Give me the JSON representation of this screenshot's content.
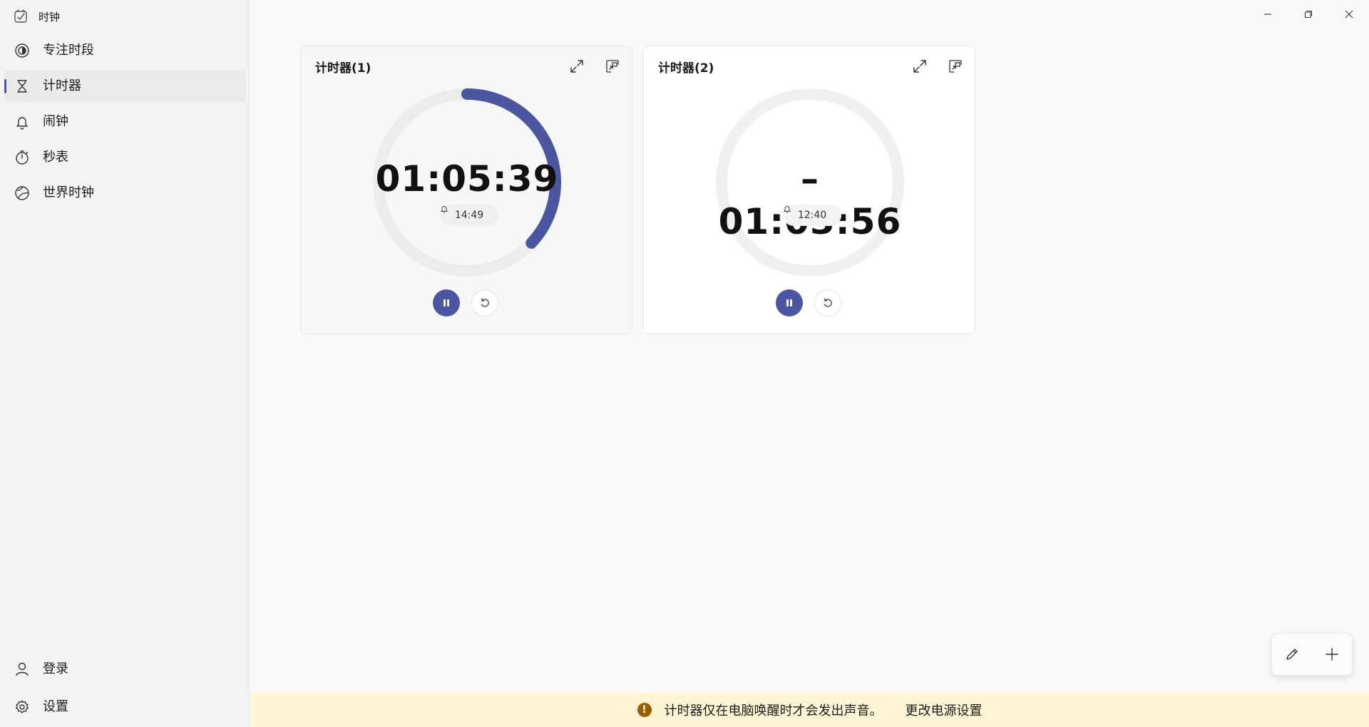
{
  "app": {
    "title": "时钟",
    "icon": "clock-app-icon"
  },
  "sidebar": {
    "items": [
      {
        "label": "专注时段",
        "icon": "focus-icon"
      },
      {
        "label": "计时器",
        "icon": "hourglass-icon",
        "selected": true
      },
      {
        "label": "闹钟",
        "icon": "bell-icon"
      },
      {
        "label": "秒表",
        "icon": "stopwatch-icon"
      },
      {
        "label": "世界时钟",
        "icon": "globe-icon"
      }
    ],
    "footer": [
      {
        "label": "登录",
        "icon": "person-icon"
      },
      {
        "label": "设置",
        "icon": "gear-icon"
      }
    ]
  },
  "timers": [
    {
      "name": "计时器(1)",
      "time": "01:05:39",
      "alarm_time": "14:49",
      "state": "running",
      "progress_remaining": 0.37,
      "ring_color": "#4b56a3"
    },
    {
      "name": "计时器(2)",
      "time": "–01:03:56",
      "alarm_time": "12:40",
      "state": "running",
      "progress_remaining": 0,
      "ring_color": "#4b56a3"
    }
  ],
  "info_bar": {
    "message": "计时器仅在电脑唤醒时才会发出声音。",
    "link": "更改电源设置",
    "icon": "warning-icon",
    "background": "#fff5d4"
  },
  "colors": {
    "accent": "#4b56a3",
    "ring_track": "#ececec",
    "warning": "#9d5d00"
  }
}
